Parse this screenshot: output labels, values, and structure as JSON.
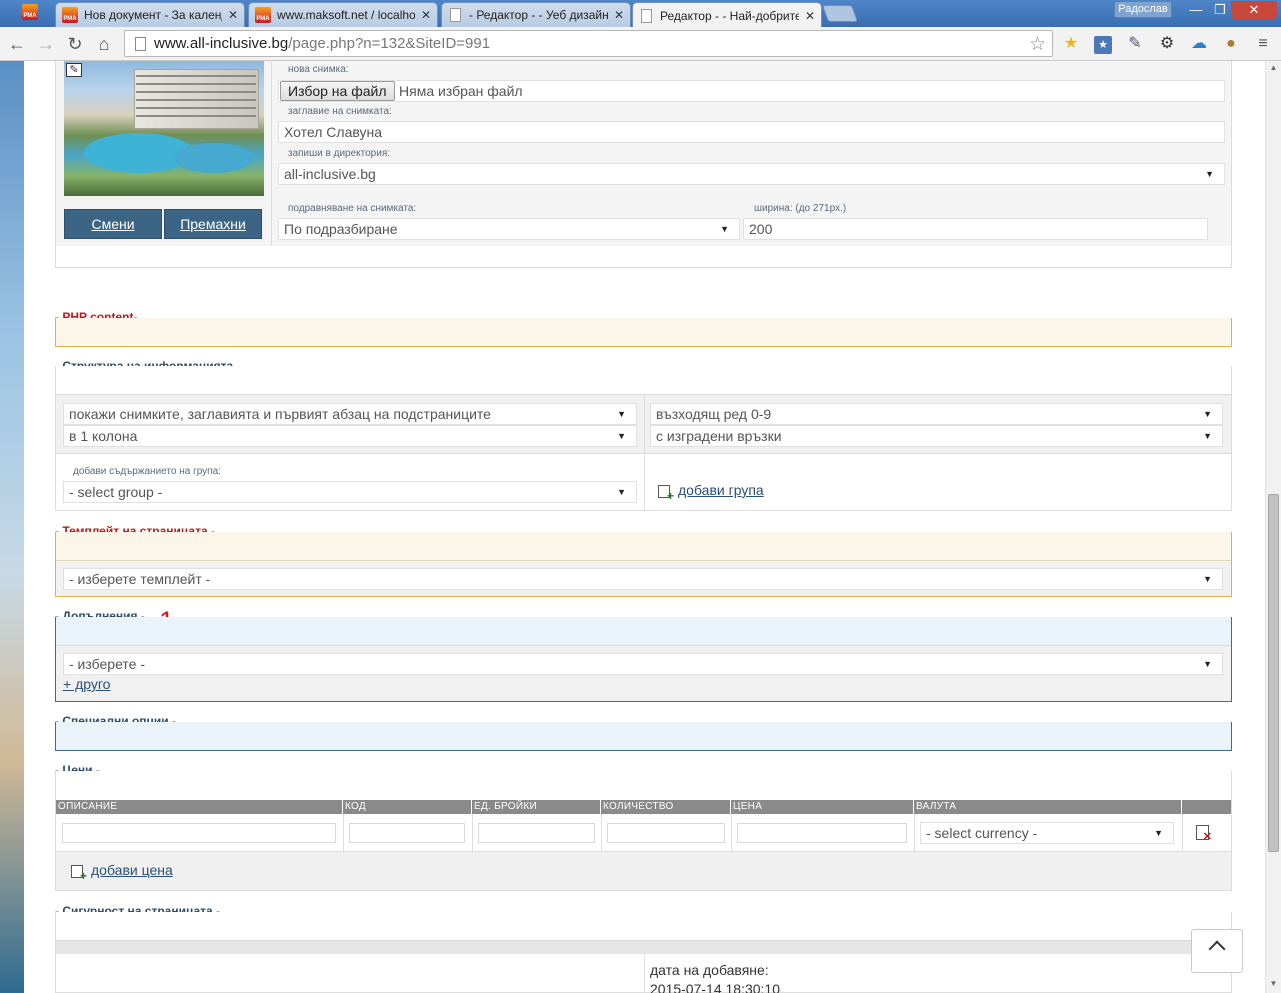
{
  "browser": {
    "tabs": [
      {
        "title": "Нов документ - За календа",
        "icon": "rma-icon"
      },
      {
        "title": "www.maksoft.net / localhost",
        "icon": "rma-icon"
      },
      {
        "title": "- Редактор - - Уеб дизайн и",
        "icon": "doc-icon"
      },
      {
        "title": "Редактор - - Най-добрите с",
        "icon": "doc-icon"
      }
    ],
    "user": "Радослав",
    "url_host": "www.all-inclusive.bg",
    "url_path": "/page.php?n=132&SiteID=991"
  },
  "image_panel": {
    "change_label": "Смени",
    "remove_label": "Премахни",
    "new_image_label": "нова снимка:",
    "choose_file_label": "Избор на файл",
    "no_file_text": "Няма избран файл",
    "image_title_label": "заглавие на снимката:",
    "image_title_value": "Хотел Славуна",
    "directory_label": "запиши в директория:",
    "directory_value": "all-inclusive.bg",
    "align_label": "подравняване на снимката:",
    "align_value": "По подразбиране",
    "width_label": "ширина: (до 271px.)",
    "width_value": "200"
  },
  "php_section": {
    "title": "PHP content"
  },
  "structure_section": {
    "title": "Структура на информацията",
    "display_value": "покажи снимките, заглавията и първият абзац на подстраниците",
    "columns_value": "в 1 колона",
    "order_value": "възходящ ред 0-9",
    "links_value": "с изградени връзки",
    "group_label": "добави съдържанието на група:",
    "group_value": "- select group -",
    "add_group_label": "добави група"
  },
  "template_section": {
    "title": "Темплейт на страницата",
    "template_value": "- изберете темплейт -"
  },
  "additions_section": {
    "title": "Допълнения",
    "marker": "1",
    "select_value": "- изберете -",
    "other_link": "+ друго"
  },
  "special_section": {
    "title": "Специални опции"
  },
  "prices_section": {
    "title": "Цени",
    "columns": [
      "ОПИСАНИЕ",
      "КОД",
      "ЕД. БРОЙКИ",
      "КОЛИЧЕСТВО",
      "ЦЕНА",
      "ВАЛУТА"
    ],
    "currency_value": "- select currency -",
    "add_price_label": "добави цена"
  },
  "security_section": {
    "title": "Сигурност на страницата",
    "date_added_label": "дата на добавяне:",
    "date_added_value": "2015-07-14 18:30:10"
  },
  "colors": {
    "table_header": "#8a8a8a",
    "button_blue": "#3c6585",
    "php_border": "#e8b040",
    "additions_border": "#3c6a95"
  }
}
